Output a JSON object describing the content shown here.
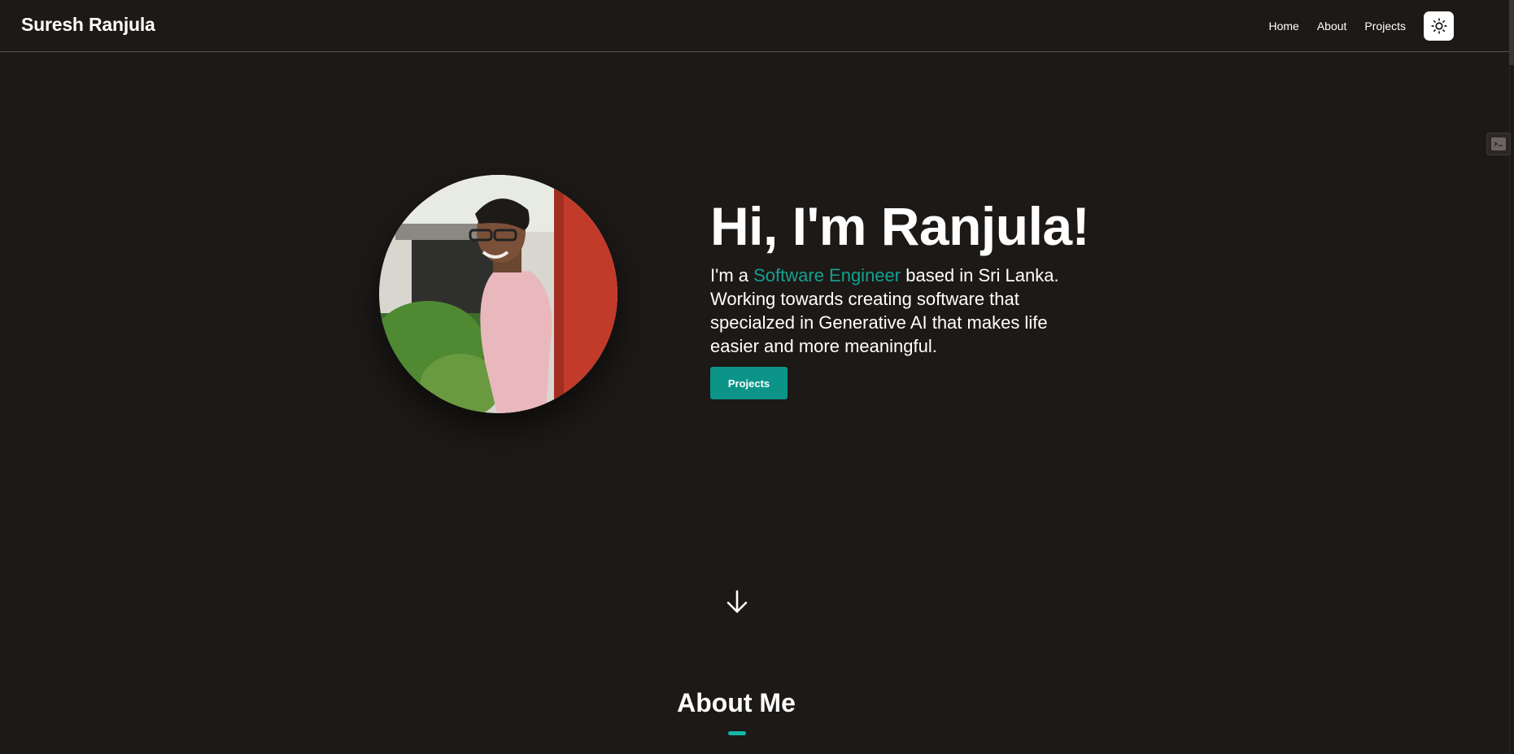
{
  "header": {
    "brand": "Suresh Ranjula",
    "nav": [
      {
        "label": "Home"
      },
      {
        "label": "About"
      },
      {
        "label": "Projects"
      }
    ],
    "theme_toggle_icon": "sun-icon"
  },
  "hero": {
    "title": "Hi, I'm Ranjula!",
    "intro_prefix": "I'm a ",
    "intro_highlight": "Software Engineer",
    "intro_suffix": " based in Sri Lanka. Working towards creating software that specialzed in Generative AI that makes life easier and more meaningful.",
    "cta_label": "Projects",
    "scroll_icon": "arrow-down-icon"
  },
  "about": {
    "title": "About Me"
  },
  "colors": {
    "background": "#1c1917",
    "accent": "#0d9488",
    "accent_text": "#14a08f"
  }
}
